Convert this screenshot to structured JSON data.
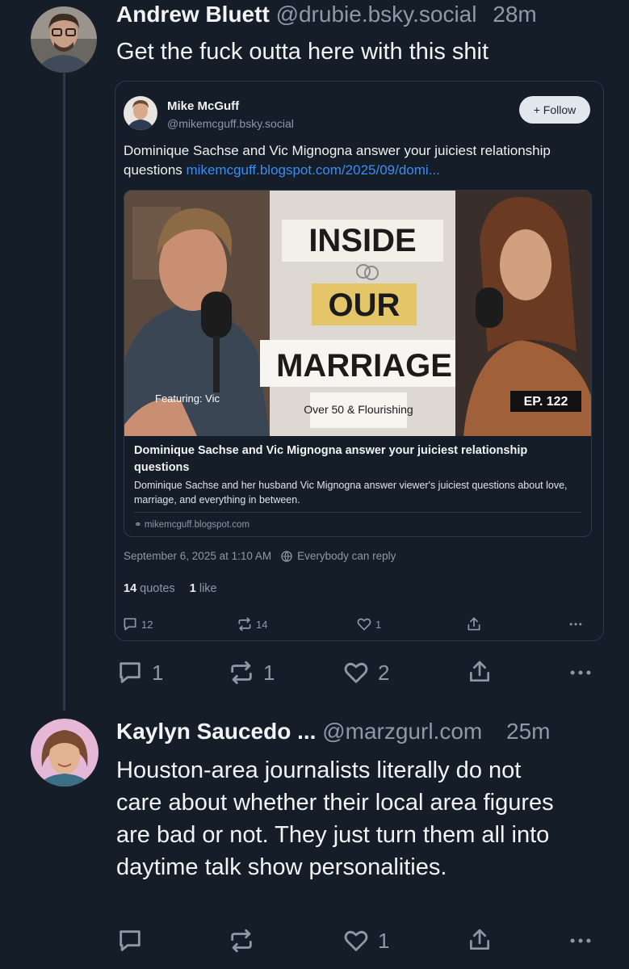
{
  "post1": {
    "name": "Andrew Bluett",
    "handle": "@drubie.bsky.social",
    "time": "28m",
    "text": "Get the fuck outta here with this shit",
    "actions": {
      "replies": "1",
      "reposts": "1",
      "likes": "2"
    }
  },
  "quote": {
    "name": "Mike McGuff",
    "handle": "@mikemcguff.bsky.social",
    "follow_label": "+ Follow",
    "text": "Dominique Sachse and Vic Mignogna answer your juiciest relationship questions",
    "link": "mikemcguff.blogspot.com/2025/09/domi...",
    "link_card": {
      "thumbnail": {
        "line1": "INSIDE",
        "line2": "OUR",
        "line3": "MARRIAGE",
        "tagline": "Over 50 & Flourishing",
        "featuring": "Featuring: Vic",
        "episode": "EP. 122"
      },
      "title": "Dominique Sachse and Vic Mignogna answer your juiciest relationship questions",
      "description": "Dominique Sachse and her husband Vic Mignogna answer viewer's juiciest questions about love, marriage, and everything in between.",
      "domain": "mikemcguff.blogspot.com"
    },
    "timestamp": "September 6, 2025 at 1:10 AM",
    "reply_setting": "Everybody can reply",
    "stats": {
      "quotes_count": "14",
      "quotes_label": "quotes",
      "likes_count": "1",
      "likes_label": "like"
    },
    "actions": {
      "replies": "12",
      "reposts": "14",
      "likes": "1"
    }
  },
  "post2": {
    "name": "Kaylyn Saucedo ...",
    "handle": "@marzgurl.com",
    "time": "25m",
    "text": "Houston-area journalists literally do not care about whether their local area figures are bad or not. They just turn them all into daytime talk show personalities.",
    "actions": {
      "likes": "1"
    }
  },
  "colors": {
    "background": "#151d28",
    "muted_text": "#8d99a8",
    "link": "#3c8cf3",
    "border": "#2c3a4b"
  }
}
